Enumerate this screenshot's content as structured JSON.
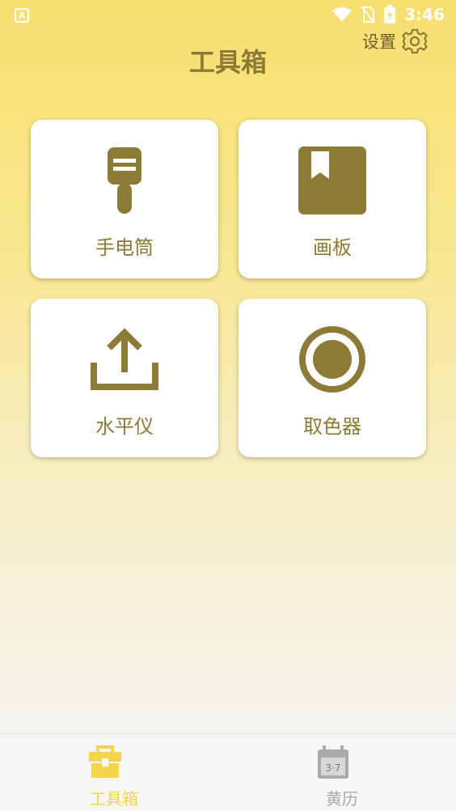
{
  "status_bar": {
    "app_glyph": "A",
    "time": "3:46",
    "icons": [
      "wifi-icon",
      "no-sim-icon",
      "battery-charging-icon"
    ]
  },
  "header": {
    "title": "工具箱",
    "settings_label": "设置",
    "settings_icon": "gear-icon"
  },
  "tools": [
    {
      "label": "手电筒",
      "icon": "flashlight-icon"
    },
    {
      "label": "画板",
      "icon": "book-bookmark-icon"
    },
    {
      "label": "水平仪",
      "icon": "upload-tray-icon"
    },
    {
      "label": "取色器",
      "icon": "radio-circle-icon"
    }
  ],
  "bottom_nav": {
    "items": [
      {
        "label": "工具箱",
        "icon": "toolbox-icon",
        "active": true
      },
      {
        "label": "黄历",
        "icon": "calendar-icon",
        "active": false
      }
    ],
    "calendar_glyph": "3·7"
  },
  "colors": {
    "accent": "#8C7A37",
    "active_nav": "#F2D54A",
    "inactive_nav": "#AAAAAA"
  }
}
